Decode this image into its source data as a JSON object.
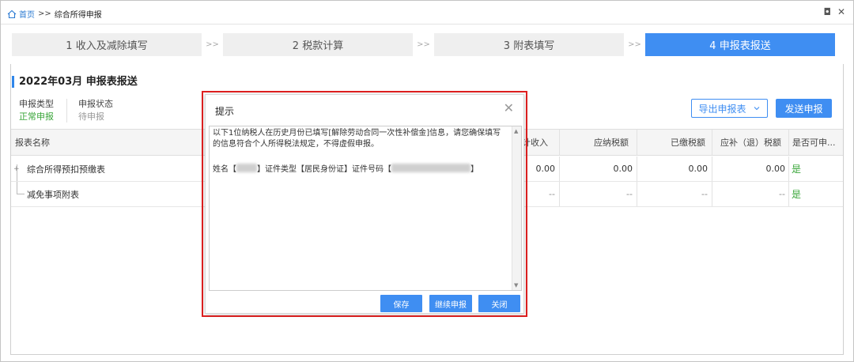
{
  "breadcrumb": {
    "home": "首页",
    "separator": ">>",
    "current": "综合所得申报"
  },
  "window_controls": {
    "restore": "◘",
    "close": "✕"
  },
  "steps": [
    {
      "label": "1 收入及减除填写",
      "active": false
    },
    {
      "label": "2 税款计算",
      "active": false
    },
    {
      "label": "3 附表填写",
      "active": false
    },
    {
      "label": "4 申报表报送",
      "active": true
    }
  ],
  "step_arrow": ">>",
  "report": {
    "title": "2022年03月  申报表报送",
    "declare_type_label": "申报类型",
    "declare_type_value": "正常申报",
    "declare_status_label": "申报状态",
    "declare_status_value": "待申报",
    "export_button": "导出申报表",
    "send_button": "发送申报"
  },
  "table": {
    "headers": {
      "name": "报表名称",
      "income": "计收入",
      "tax_payable": "应纳税额",
      "tax_paid": "已缴税额",
      "refund": "应补（退）税额",
      "can_declare": "是否可申..."
    },
    "rows": [
      {
        "toggle": "+",
        "name": "综合所得预扣预缴表",
        "income": "0.00",
        "tax_payable": "0.00",
        "tax_paid": "0.00",
        "refund": "0.00",
        "can_declare": "是"
      },
      {
        "toggle": "",
        "name": "减免事项附表",
        "income": "--",
        "tax_payable": "--",
        "tax_paid": "--",
        "refund": "--",
        "can_declare": "是"
      }
    ]
  },
  "dialog": {
    "title": "提示",
    "close": "✕",
    "message": "以下1位纳税人在历史月份已填写[解除劳动合同一次性补偿金]信息，请您确保填写的信息符合个人所得税法规定，不得虚假申报。",
    "name_prefix": "姓名【",
    "id_type_text": "】证件类型【居民身份证】证件号码【",
    "end_bracket": "】",
    "buttons": {
      "save": "保存",
      "continue": "继续申报",
      "close": "关闭"
    }
  },
  "colors": {
    "accent": "#3f8ef2",
    "ok": "#3aa63a",
    "highlight_frame": "#e02020"
  }
}
